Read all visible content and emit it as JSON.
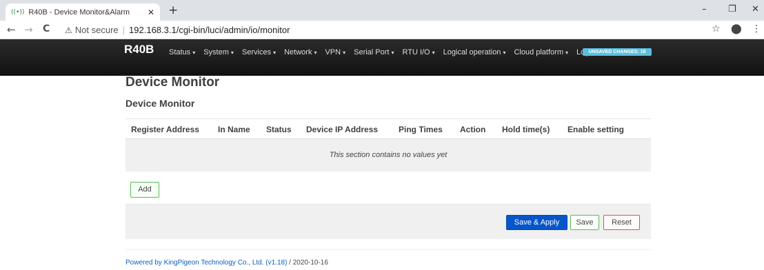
{
  "browser": {
    "tab_title": "R40B - Device Monitor&Alarm",
    "tab_close": "✕",
    "new_tab": "+",
    "minimize": "–",
    "restore": "❐",
    "close": "✕",
    "back": "←",
    "forward": "→",
    "reload": "C",
    "security_icon": "⚠",
    "security_text": "Not secure",
    "url": "192.168.3.1/cgi-bin/luci/admin/io/monitor",
    "star_icon": "☆",
    "profile_icon": "⬤",
    "menu_icon": "⋮"
  },
  "header": {
    "brand": "R40B",
    "menu": [
      {
        "label": "Status",
        "caret": "▾"
      },
      {
        "label": "System",
        "caret": "▾"
      },
      {
        "label": "Services",
        "caret": "▾"
      },
      {
        "label": "Network",
        "caret": "▾"
      },
      {
        "label": "VPN",
        "caret": "▾"
      },
      {
        "label": "Serial Port",
        "caret": "▾"
      },
      {
        "label": "RTU I/O",
        "caret": "▾"
      },
      {
        "label": "Logical operation",
        "caret": "▾"
      },
      {
        "label": "Cloud platform",
        "caret": "▾"
      },
      {
        "label": "Logout",
        "caret": ""
      }
    ],
    "unsaved_badge": "UNSAVED CHANGES: 18",
    "accent_color": "#5bc0de"
  },
  "main": {
    "page_title": "Device Monitor",
    "section_title": "Device Monitor",
    "table": {
      "columns": [
        "Register Address",
        "In Name",
        "Status",
        "Device IP Address",
        "Ping Times",
        "Action",
        "Hold time(s)",
        "Enable setting"
      ],
      "empty_text": "This section contains no values yet"
    },
    "add_label": "Add",
    "save_apply_label": "Save & Apply",
    "save_label": "Save",
    "reset_label": "Reset",
    "primary_color": "#0756c9"
  },
  "footer": {
    "link_text": "Powered by KingPigeon Technology Co., Ltd. (v1.18)",
    "date_text": " / 2020-10-16"
  }
}
